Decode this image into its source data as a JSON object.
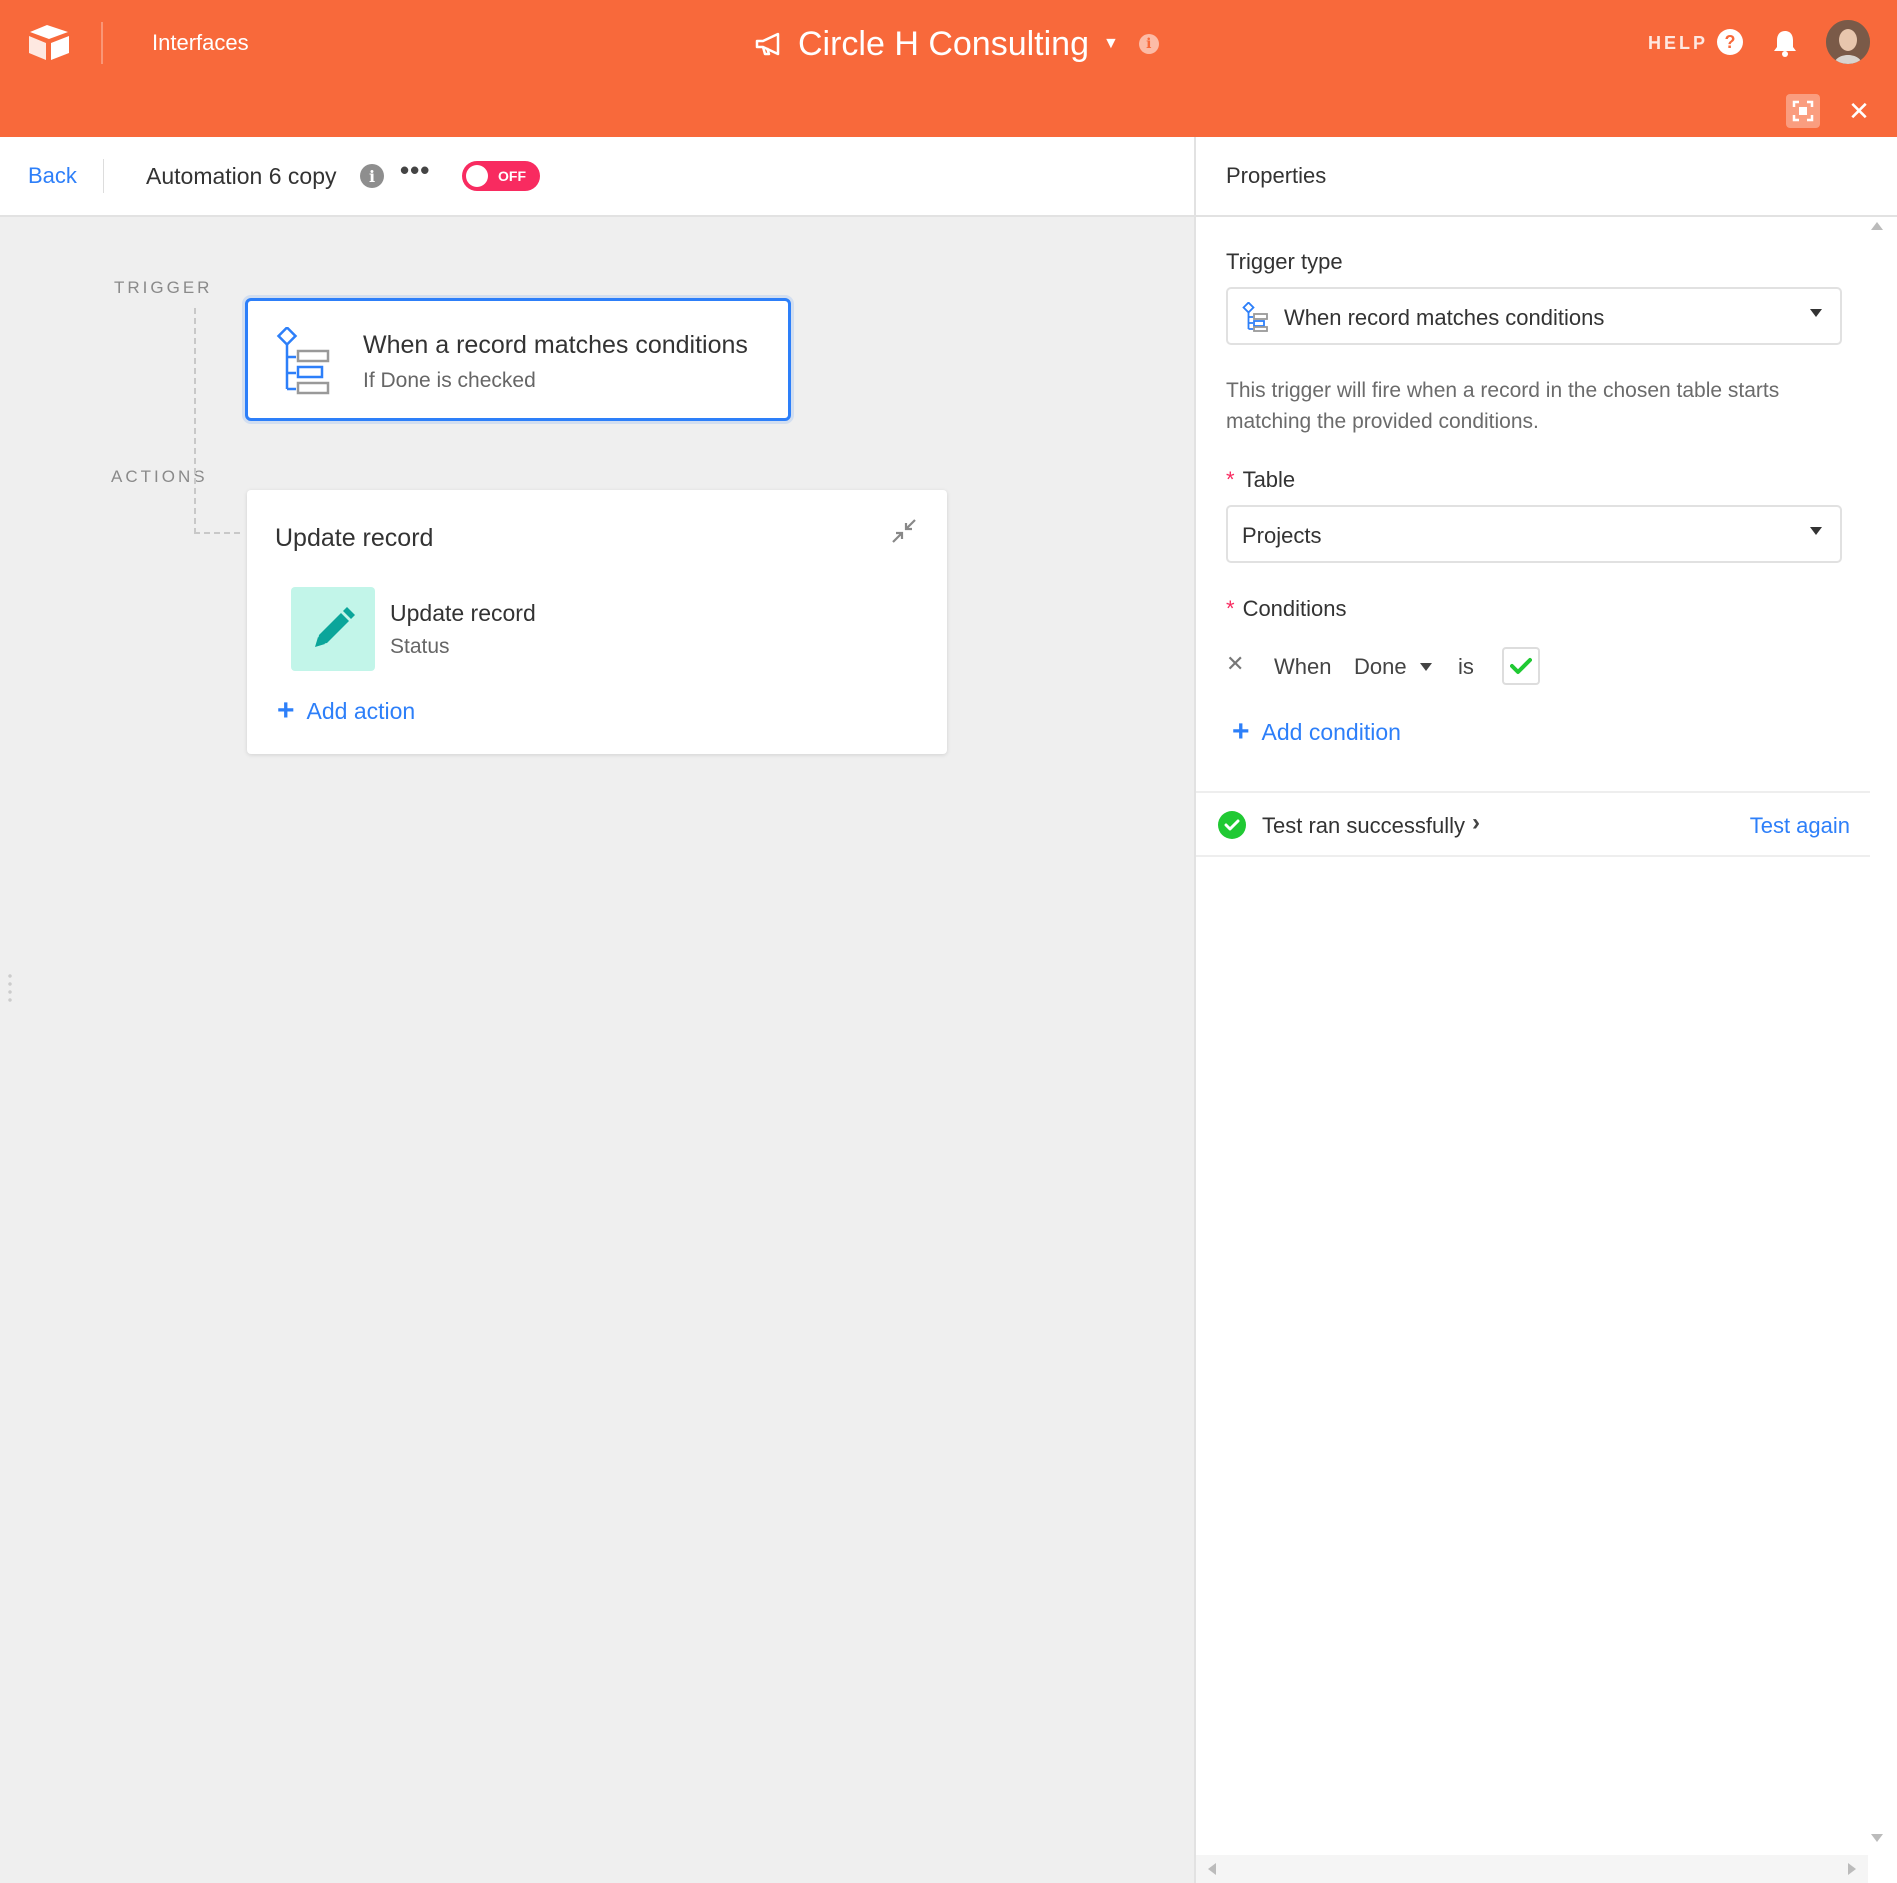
{
  "header": {
    "nav_label": "Interfaces",
    "base_name": "Circle H Consulting",
    "help_label": "HELP",
    "brand_color": "#f8693b",
    "icons": [
      "airtable-logo-icon",
      "megaphone-icon",
      "info-icon",
      "help-icon",
      "bell-icon",
      "avatar",
      "expand-icon",
      "close-icon"
    ]
  },
  "toolbar": {
    "back_label": "Back",
    "automation_name": "Automation 6 copy",
    "more_label": "•••",
    "toggle_label": "OFF",
    "toggle_color": "#f82b60"
  },
  "canvas": {
    "trigger_label": "TRIGGER",
    "actions_label": "ACTIONS",
    "trigger": {
      "title": "When a record matches conditions",
      "subtitle": "If Done is checked"
    },
    "action_group": {
      "heading": "Update record",
      "action": {
        "title": "Update record",
        "subtitle": "Status"
      },
      "add_action_label": "Add action"
    }
  },
  "properties": {
    "title": "Properties",
    "trigger_type_label": "Trigger type",
    "trigger_type_value": "When record matches conditions",
    "help_text": "This trigger will fire when a record in the chosen table starts matching the provided conditions.",
    "table_label": "Table",
    "table_value": "Projects",
    "conditions_label": "Conditions",
    "condition": {
      "remove_label": "✕",
      "when_label": "When",
      "field": "Done",
      "operator": "is",
      "checked": true
    },
    "add_condition_label": "Add condition",
    "test_message": "Test ran successfully",
    "test_again_label": "Test again",
    "success_color": "#20c933",
    "link_color": "#2d7ff9"
  }
}
